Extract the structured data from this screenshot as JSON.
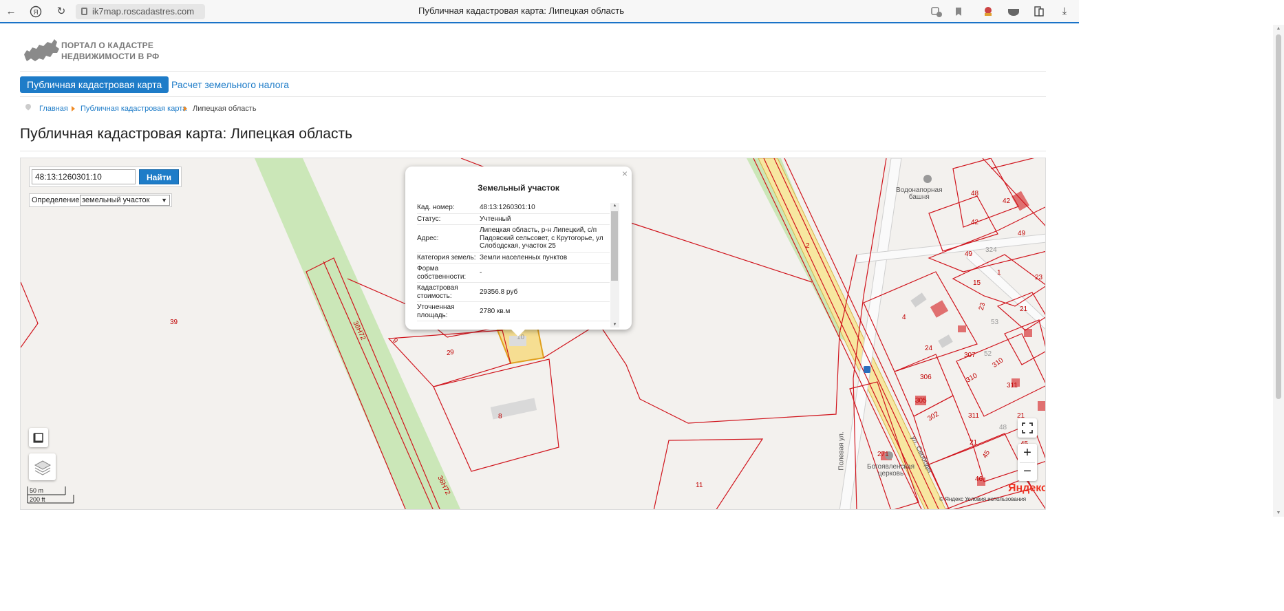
{
  "browser": {
    "url": "ik7map.roscadastres.com",
    "tab_title": "Публичная кадастровая карта: Липецкая область"
  },
  "header": {
    "logo_line1": "ПОРТАЛ О КАДАСТРЕ",
    "logo_line2": "НЕДВИЖИМОСТИ В РФ"
  },
  "nav": {
    "active": "Публичная кадастровая карта",
    "link": "Расчет земельного налога"
  },
  "breadcrumb": {
    "home": "Главная",
    "map": "Публичная кадастровая карта",
    "current": "Липецкая область"
  },
  "page_title": "Публичная кадастровая карта: Липецкая область",
  "search": {
    "value": "48:13:1260301:10",
    "button": "Найти",
    "definition_label": "Определение:",
    "definition_value": "земельный участок"
  },
  "popup": {
    "close": "×",
    "title": "Земельный участок",
    "rows": [
      {
        "key": "Кад. номер:",
        "value": "48:13:1260301:10"
      },
      {
        "key": "Статус:",
        "value": "Учтенный"
      },
      {
        "key": "Адрес:",
        "value": "Липецкая область, р-н Липецкий, с/п Падовский сельсовет, с Крутогорье, ул Слободская, участок 25"
      },
      {
        "key": "Категория земель:",
        "value": "Земли населенных пунктов"
      },
      {
        "key": "Форма собственности:",
        "value": "-"
      },
      {
        "key": "Кадастровая стоимость:",
        "value": "29356.8 руб"
      },
      {
        "key": "Уточненная площадь:",
        "value": "2780 кв.м"
      }
    ]
  },
  "map_labels": {
    "l39": "39",
    "l2": "2",
    "l9a": "9",
    "l9b": "9",
    "l10": "10",
    "l8": "8",
    "l11": "11",
    "road1": "36Н72",
    "road2": "36Н72",
    "tower": "Водонапорная\nбашня",
    "church": "Богоявленская\nцерковь",
    "street1": "ул. Свободы",
    "street2": "Полевая ул.",
    "n48": "48",
    "n42a": "42",
    "n42b": "42",
    "n49a": "49",
    "n49b": "49",
    "n324": "324",
    "n1": "1",
    "n15": "15",
    "n23a": "23",
    "n23b": "23",
    "n21a": "21",
    "n4": "4",
    "n24": "24",
    "n307": "307",
    "n52": "52",
    "n53": "53",
    "n310a": "310",
    "n310b": "310",
    "n306": "306",
    "n305": "305",
    "n302": "302",
    "n311a": "311",
    "n311b": "311",
    "n21b": "21",
    "n21c": "21",
    "n48b": "48",
    "n45a": "45",
    "n45b": "45",
    "n46": "46",
    "n271": "271",
    "n2r": "2"
  },
  "scale": {
    "m": "50 m",
    "ft": "200 ft"
  },
  "attribution": {
    "logo": "Яндекс",
    "terms": "© Яндекс  Условия использования"
  }
}
